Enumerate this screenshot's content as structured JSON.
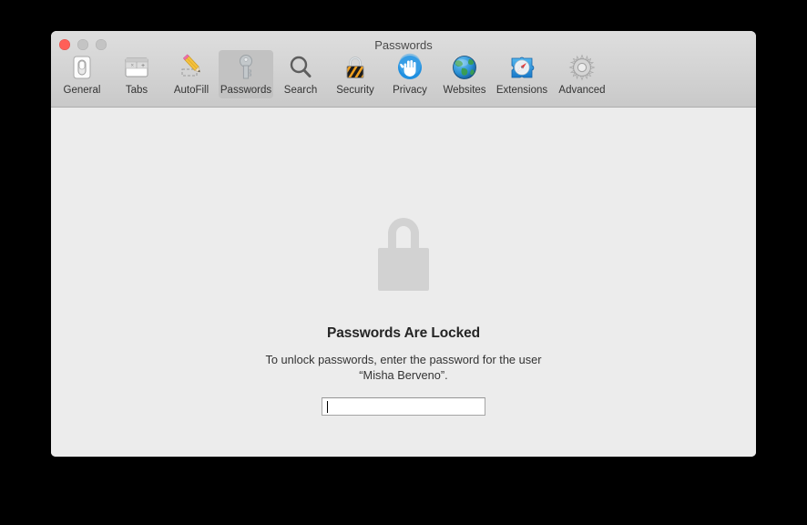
{
  "window": {
    "title": "Passwords",
    "controls": {
      "close": "close-button",
      "minimize": "minimize-button",
      "zoom": "zoom-button"
    }
  },
  "toolbar": {
    "items": [
      {
        "label": "General",
        "icon": "general-switch-icon",
        "selected": false
      },
      {
        "label": "Tabs",
        "icon": "tabs-window-icon",
        "selected": false
      },
      {
        "label": "AutoFill",
        "icon": "autofill-pencil-icon",
        "selected": false
      },
      {
        "label": "Passwords",
        "icon": "passwords-key-icon",
        "selected": true
      },
      {
        "label": "Search",
        "icon": "search-magnifier-icon",
        "selected": false
      },
      {
        "label": "Security",
        "icon": "security-padlock-icon",
        "selected": false
      },
      {
        "label": "Privacy",
        "icon": "privacy-hand-icon",
        "selected": false
      },
      {
        "label": "Websites",
        "icon": "websites-globe-icon",
        "selected": false
      },
      {
        "label": "Extensions",
        "icon": "extensions-puzzle-icon",
        "selected": false
      },
      {
        "label": "Advanced",
        "icon": "advanced-gear-icon",
        "selected": false
      }
    ]
  },
  "content": {
    "lock_icon": "lock-closed-icon",
    "heading": "Passwords Are Locked",
    "message": "To unlock passwords, enter the password for the user “Misha Berveno”.",
    "password_field": {
      "value": "",
      "placeholder": ""
    }
  },
  "colors": {
    "window_background": "#ececec",
    "toolbar_top": "#dedede",
    "toolbar_bottom": "#c9c9c9",
    "selection": "#c2c2c2",
    "close_button": "#ff5f57",
    "inactive_button": "#c4c4c4",
    "lock_gray": "#d2d2d2",
    "heading_text": "#252525",
    "body_text": "#333333"
  }
}
